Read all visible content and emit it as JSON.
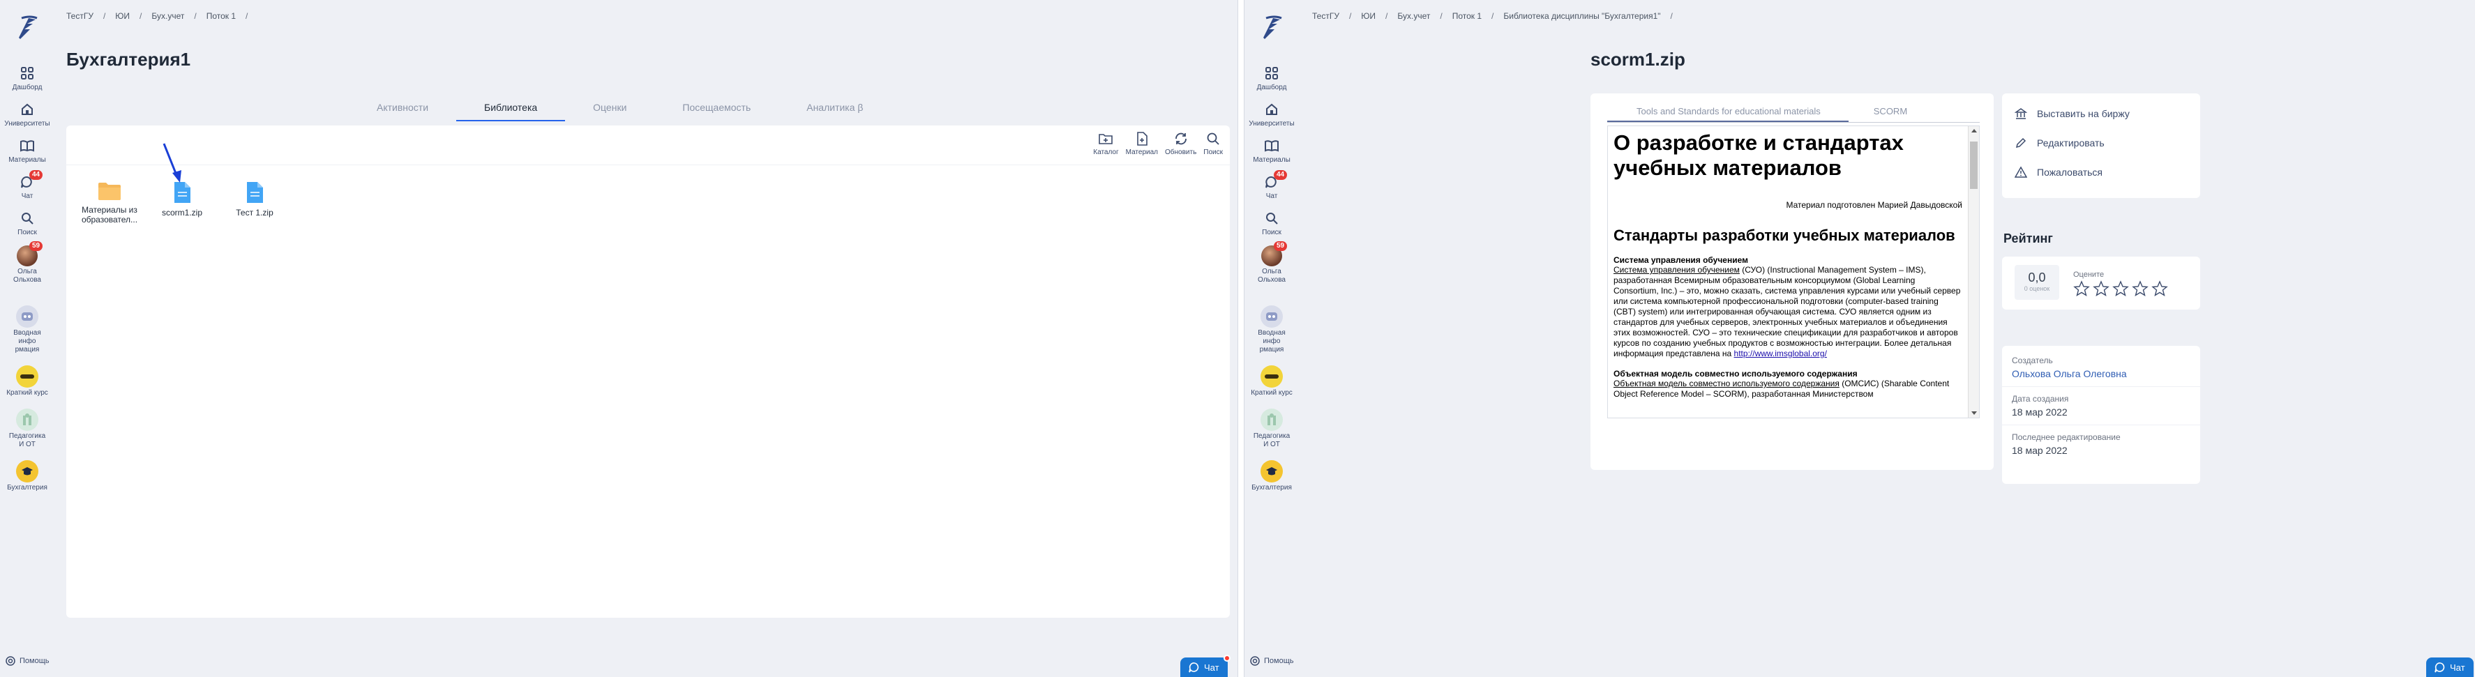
{
  "sidebar": {
    "items": [
      {
        "icon": "dashboard-icon",
        "label": "Дашборд"
      },
      {
        "icon": "university-icon",
        "label": "Университеты"
      },
      {
        "icon": "book-icon",
        "label": "Материалы"
      },
      {
        "icon": "chat-icon",
        "label": "Чат",
        "badge": "44"
      },
      {
        "icon": "search-icon",
        "label": "Поиск"
      },
      {
        "icon": "avatar",
        "label": "Ольга Ольхова",
        "badge": "59"
      }
    ],
    "courses": [
      {
        "icon": "course-intro-icon",
        "label": "Вводная инфо рмация"
      },
      {
        "icon": "course-short-icon",
        "label": "Краткий курс"
      },
      {
        "icon": "course-pedagogy-icon",
        "label": "Педагогика И ОТ"
      },
      {
        "icon": "course-accounting-icon",
        "label": "Бухгалтерия"
      }
    ],
    "help_label": "Помощь"
  },
  "left": {
    "breadcrumb": [
      "ТестГУ",
      "ЮИ",
      "Бух.учет",
      "Поток 1"
    ],
    "title": "Бухгалтерия1",
    "tabs": [
      "Активности",
      "Библиотека",
      "Оценки",
      "Посещаемость",
      "Аналитика β"
    ],
    "active_tab": "Библиотека",
    "toolbar": [
      {
        "icon": "folder-add-icon",
        "label": "Каталог"
      },
      {
        "icon": "file-add-icon",
        "label": "Материал"
      },
      {
        "icon": "refresh-icon",
        "label": "Обновить"
      },
      {
        "icon": "search-icon",
        "label": "Поиск"
      }
    ],
    "files": [
      {
        "type": "folder",
        "name": "Материалы из образовател..."
      },
      {
        "type": "file",
        "name": "scorm1.zip"
      },
      {
        "type": "file",
        "name": "Тест 1.zip"
      }
    ],
    "chat_label": "Чат"
  },
  "right": {
    "breadcrumb": [
      "ТестГУ",
      "ЮИ",
      "Бух.учет",
      "Поток 1",
      "Библиотека дисциплины \"Бухгалтерия1\""
    ],
    "title": "scorm1.zip",
    "viewer_tabs": [
      "Tools and Standards for educational materials",
      "SCORM"
    ],
    "doc": {
      "h1": "О разработке и стандартах учебных материалов",
      "author": "Материал подготовлен Марией Давыдовской",
      "h2": "Стандарты разработки учебных материалов",
      "s1_title": "Система управления обучением",
      "s1_link": "Система управления обучением",
      "s1_text": " (СУО) (Instructional Management System – IMS), разработанная Всемирным образовательным консорциумом (Global Learning Consortium, Inc.) – это, можно сказать, система управления курсами или учебный сервер или система компьютерной профессиональной подготовки (computer-based training (CBT) system) или интегрированная обучающая система. СУО является одним из стандартов для учебных серверов, электронных учебных материалов и объединения этих возможностей. СУО – это технические спецификации для разработчиков и авторов курсов по созданию учебных продуктов с возможностью интеграции. Более детальная информация представлена на ",
      "s1_url": "http://www.imsglobal.org/",
      "s2_title": "Объектная модель совместно используемого содержания",
      "s2_link": "Объектная модель совместно используемого содержания",
      "s2_text": " (ОМСИС) (Sharable Content Object Reference Model – SCORM), разработанная Министерством"
    },
    "actions": [
      {
        "icon": "exchange-icon",
        "label": "Выставить на биржу"
      },
      {
        "icon": "edit-icon",
        "label": "Редактировать"
      },
      {
        "icon": "warning-icon",
        "label": "Пожаловаться"
      }
    ],
    "rating": {
      "title": "Рейтинг",
      "value": "0,0",
      "count": "0 оценок",
      "rate_label": "Оцените",
      "stars": 5
    },
    "meta": {
      "creator_label": "Создатель",
      "creator": "Ольхова Ольга Олеговна",
      "created_label": "Дата создания",
      "created": "18 мар 2022",
      "edited_label": "Последнее редактирование",
      "edited": "18 мар 2022"
    },
    "chat_label": "Чат"
  }
}
